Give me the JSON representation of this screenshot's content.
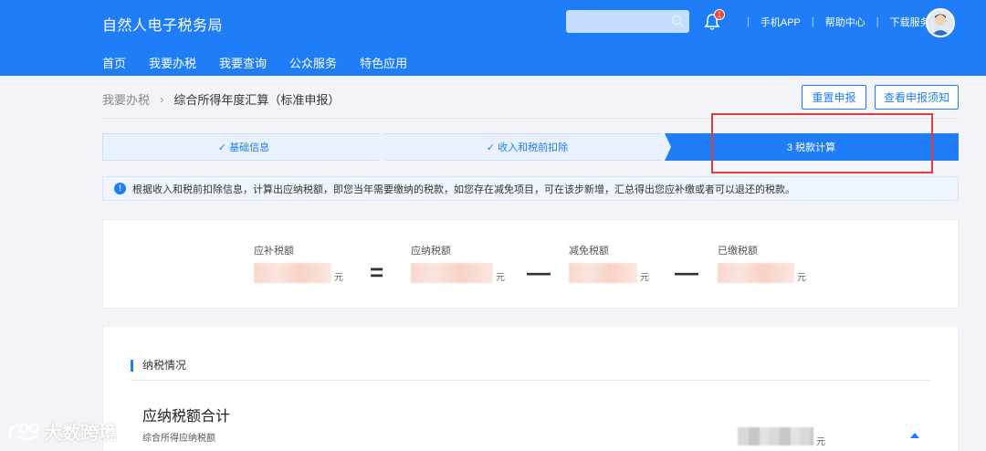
{
  "header": {
    "brand": "自然人电子税务局",
    "notification_count": "1",
    "links": [
      "手机APP",
      "帮助中心",
      "下载服务"
    ]
  },
  "nav": [
    "首页",
    "我要办税",
    "我要查询",
    "公众服务",
    "特色应用"
  ],
  "breadcrumb": {
    "parent": "我要办税",
    "current": "综合所得年度汇算（标准申报）"
  },
  "actions": {
    "reset": "重置申报",
    "notice": "查看申报须知"
  },
  "steps": [
    {
      "label": "✓ 基础信息",
      "state": "done"
    },
    {
      "label": "✓ 收入和税前扣除",
      "state": "done"
    },
    {
      "label": "3 税款计算",
      "state": "active"
    }
  ],
  "info": "根据收入和税前扣除信息，计算出应纳税额，即您当年需要缴纳的税款，如您存在减免项目，可在该步新增，汇总得出您应补缴或者可以退还的税款。",
  "formula": {
    "items": [
      {
        "label": "应补税额",
        "unit": "元"
      },
      {
        "label": "应纳税额",
        "unit": "元"
      },
      {
        "label": "减免税额",
        "unit": "元"
      },
      {
        "label": "已缴税额",
        "unit": "元"
      }
    ],
    "operators": [
      "=",
      "—",
      "—"
    ]
  },
  "tax_section": {
    "title": "纳税情况",
    "total_title": "应纳税额合计",
    "sub_label": "综合所得应纳税额",
    "unit": "元"
  },
  "watermark": "大数跨境",
  "colors": {
    "primary": "#1f7ef7",
    "highlight": "#e33b3b"
  }
}
